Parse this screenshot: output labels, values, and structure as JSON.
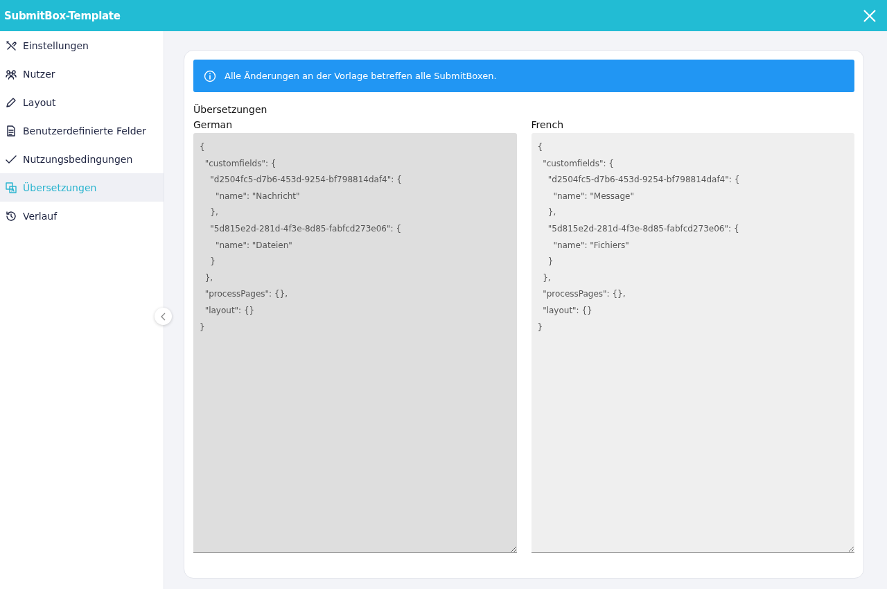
{
  "window": {
    "title": "SubmitBox-Template"
  },
  "sidebar": {
    "items": [
      {
        "label": "Einstellungen",
        "selected": false
      },
      {
        "label": "Nutzer",
        "selected": false
      },
      {
        "label": "Layout",
        "selected": false
      },
      {
        "label": "Benutzerdefinierte Felder",
        "selected": false
      },
      {
        "label": "Nutzungsbedingungen",
        "selected": false
      },
      {
        "label": "Übersetzungen",
        "selected": true
      },
      {
        "label": "Verlauf",
        "selected": false
      }
    ]
  },
  "notice": {
    "text": "Alle Änderungen an der Vorlage betreffen alle SubmitBoxen."
  },
  "section_title": "Übersetzungen",
  "editors": [
    {
      "label": "German",
      "disabled": true,
      "value": "{\n  \"customfields\": {\n    \"d2504fc5-d7b6-453d-9254-bf798814daf4\": {\n      \"name\": \"Nachricht\"\n    },\n    \"5d815e2d-281d-4f3e-8d85-fabfcd273e06\": {\n      \"name\": \"Dateien\"\n    }\n  },\n  \"processPages\": {},\n  \"layout\": {}\n}"
    },
    {
      "label": "French",
      "disabled": false,
      "value": "{\n  \"customfields\": {\n    \"d2504fc5-d7b6-453d-9254-bf798814daf4\": {\n      \"name\": \"Message\"\n    },\n    \"5d815e2d-281d-4f3e-8d85-fabfcd273e06\": {\n      \"name\": \"Fichiers\"\n    }\n  },\n  \"processPages\": {},\n  \"layout\": {}\n}"
    }
  ]
}
